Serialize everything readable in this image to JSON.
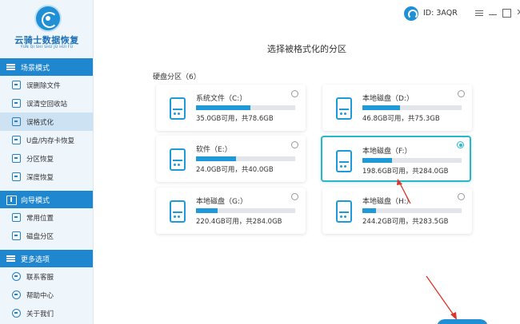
{
  "brand": {
    "name": "云骑士数据恢复",
    "sub": "YUN QI SHI SHU JU HUI FU"
  },
  "sidebar": {
    "sections": [
      {
        "title": "场景模式",
        "icon": "list-icon",
        "items": [
          {
            "label": "误删除文件",
            "icon": "file-delete-icon"
          },
          {
            "label": "误清空回收站",
            "icon": "recycle-bin-icon"
          },
          {
            "label": "误格式化",
            "icon": "format-icon",
            "active": true
          },
          {
            "label": "U盘/内存卡恢复",
            "icon": "usb-drive-icon"
          },
          {
            "label": "分区恢复",
            "icon": "partition-icon"
          },
          {
            "label": "深度恢复",
            "icon": "deep-scan-icon"
          }
        ]
      },
      {
        "title": "向导模式",
        "icon": "wizard-icon",
        "items": [
          {
            "label": "常用位置",
            "icon": "common-location-icon"
          },
          {
            "label": "磁盘分区",
            "icon": "disk-partition-icon"
          }
        ]
      },
      {
        "title": "更多选项",
        "icon": "list-icon",
        "items": [
          {
            "label": "联系客服",
            "icon": "customer-service-icon"
          },
          {
            "label": "帮助中心",
            "icon": "help-center-icon"
          },
          {
            "label": "关于我们",
            "icon": "about-icon"
          }
        ]
      }
    ]
  },
  "topbar": {
    "user_id": "ID: 3AQR",
    "close_glyph": "✕"
  },
  "main": {
    "title": "选择被格式化的分区",
    "group_label": "硬盘分区（6）"
  },
  "partitions": [
    {
      "name": "系统文件（C:）",
      "info": "35.0GB可用，共78.6GB",
      "used_fraction": 0.55,
      "selected": false
    },
    {
      "name": "本地磁盘（D:）",
      "info": "46.8GB可用，共75.3GB",
      "used_fraction": 0.38,
      "selected": false
    },
    {
      "name": "软件（E:）",
      "info": "24.0GB可用，共40.0GB",
      "used_fraction": 0.4,
      "selected": false
    },
    {
      "name": "本地磁盘（F:）",
      "info": "198.6GB可用，共284.0GB",
      "used_fraction": 0.3,
      "selected": true
    },
    {
      "name": "本地磁盘（G:）",
      "info": "220.4GB可用，共284.0GB",
      "used_fraction": 0.22,
      "selected": false
    },
    {
      "name": "本地磁盘（H:）",
      "info": "244.2GB可用，共283.5GB",
      "used_fraction": 0.14,
      "selected": false
    }
  ],
  "colors": {
    "accent": "#1f86d0",
    "bar_fill": "#1f9ad9",
    "selected_border": "#2ab7c8",
    "annotation_arrow": "#d9362b"
  }
}
